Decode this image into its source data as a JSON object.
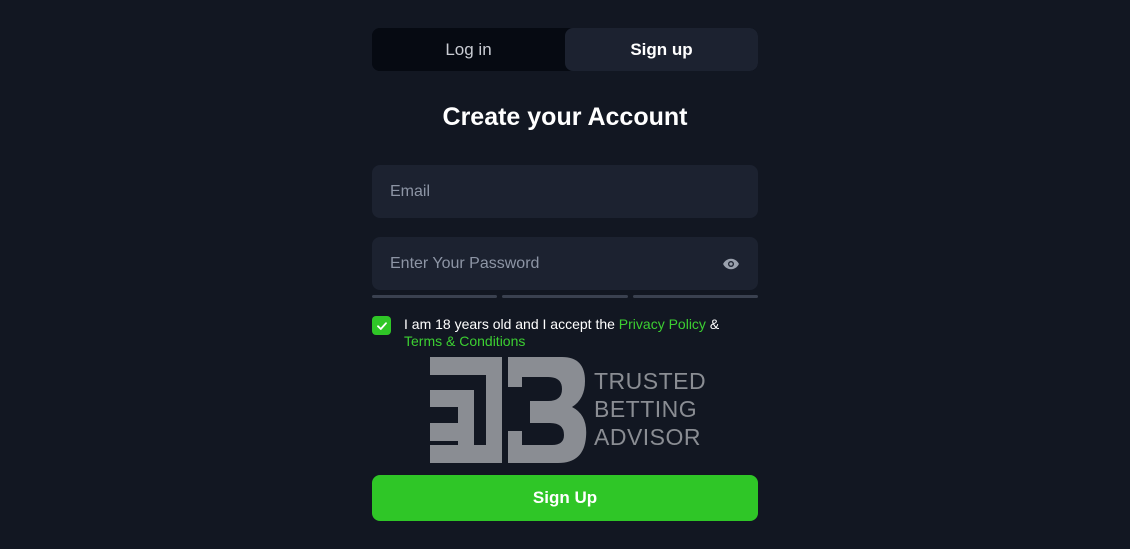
{
  "tabs": {
    "login_label": "Log in",
    "signup_label": "Sign up",
    "active": "signup"
  },
  "title": "Create your Account",
  "email": {
    "placeholder": "Email",
    "value": ""
  },
  "password": {
    "placeholder": "Enter Your Password",
    "value": "",
    "toggle_icon": "eye-icon"
  },
  "consent": {
    "checked": true,
    "text_before": "I am 18 years old and I accept the ",
    "privacy_label": "Privacy Policy",
    "connector": " &",
    "terms_label": "Terms & Conditions"
  },
  "badge": {
    "line1": "TRUSTED",
    "line2": "BETTING",
    "line3": "ADVISOR"
  },
  "signup_button_label": "Sign Up",
  "colors": {
    "background": "#121722",
    "field": "#1c2230",
    "accent": "#2fc627",
    "link": "#3ccf32"
  }
}
